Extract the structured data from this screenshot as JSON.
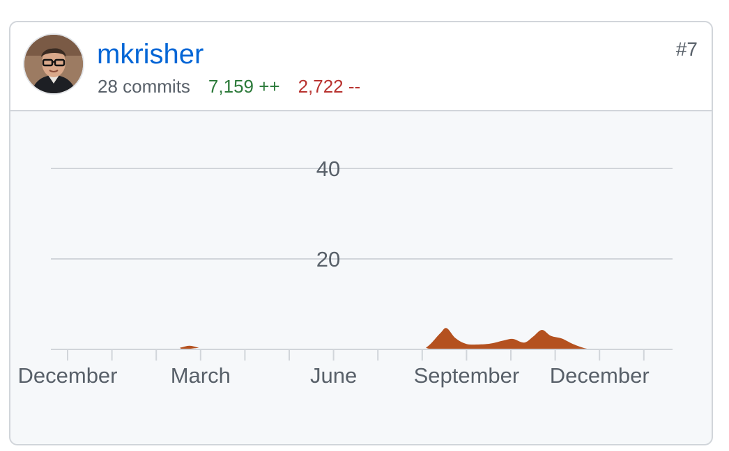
{
  "contributor": {
    "username": "mkrisher",
    "commits_label": "28 commits",
    "additions_label": "7,159 ++",
    "deletions_label": "2,722 --",
    "rank": "#7",
    "avatar_icon": "person-avatar"
  },
  "colors": {
    "link": "#0366d6",
    "additions": "#2c7a3a",
    "deletions": "#b8322f",
    "area_fill": "#b4511f",
    "grid": "#d1d5da",
    "panel_bg": "#f6f8fa"
  },
  "chart_data": {
    "type": "area",
    "ylim": [
      0,
      50
    ],
    "y_ticks": [
      20,
      40
    ],
    "y_tick_labels": [
      "20",
      "40"
    ],
    "x_labels": [
      "December",
      "March",
      "June",
      "September",
      "December"
    ],
    "x_label_month_index": [
      0,
      3,
      6,
      9,
      12
    ],
    "x_month_ticks": 14,
    "series": [
      {
        "points": [
          [
            0,
            0
          ],
          [
            2.3,
            0
          ],
          [
            2.55,
            0.4
          ],
          [
            2.75,
            0.8
          ],
          [
            2.95,
            0.4
          ],
          [
            3.2,
            0
          ],
          [
            7.8,
            0
          ],
          [
            8.1,
            0.5
          ],
          [
            8.4,
            3.5
          ],
          [
            8.55,
            4.7
          ],
          [
            8.75,
            2.5
          ],
          [
            9.0,
            1.2
          ],
          [
            9.3,
            1.1
          ],
          [
            9.55,
            1.3
          ],
          [
            9.85,
            2.0
          ],
          [
            10.05,
            2.3
          ],
          [
            10.3,
            1.5
          ],
          [
            10.5,
            2.8
          ],
          [
            10.7,
            4.3
          ],
          [
            10.9,
            3.0
          ],
          [
            11.15,
            2.4
          ],
          [
            11.4,
            1.2
          ],
          [
            11.7,
            0.2
          ],
          [
            12.0,
            0
          ],
          [
            13.0,
            0
          ]
        ]
      }
    ]
  }
}
